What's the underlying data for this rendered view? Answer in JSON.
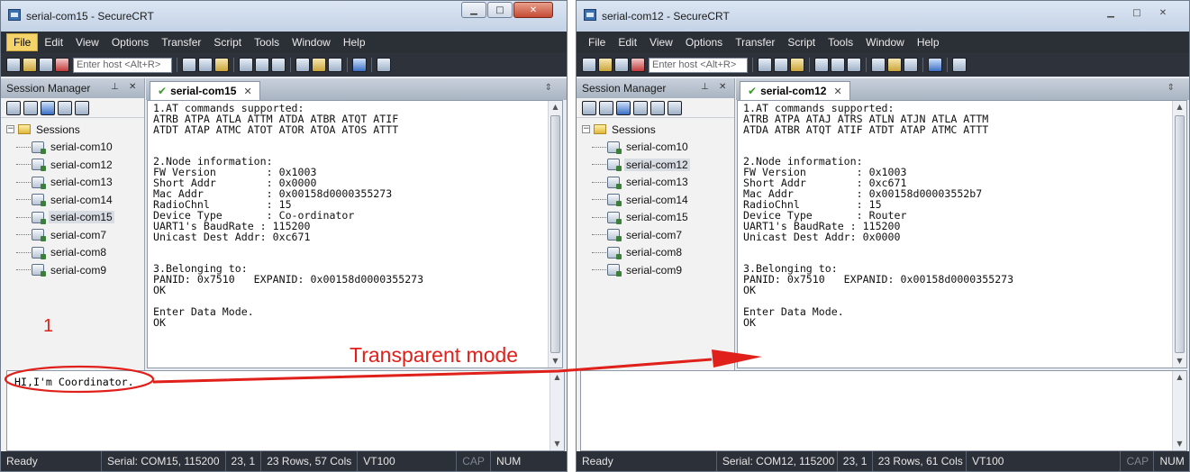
{
  "window_left": {
    "title": "serial-com15 - SecureCRT",
    "menu": [
      "File",
      "Edit",
      "View",
      "Options",
      "Transfer",
      "Script",
      "Tools",
      "Window",
      "Help"
    ],
    "host_placeholder": "Enter host <Alt+R>",
    "session_manager": {
      "title": "Session Manager",
      "root": "Sessions",
      "items": [
        "serial-com10",
        "serial-com12",
        "serial-com13",
        "serial-com14",
        "serial-com15",
        "serial-com7",
        "serial-com8",
        "serial-com9"
      ],
      "selected": "serial-com15"
    },
    "tab": "serial-com15",
    "terminal_lines": [
      "1.AT commands supported:",
      "ATRB ATPA ATLA ATTM ATDA ATBR ATQT ATIF",
      "ATDT ATAP ATMC ATOT ATOR ATOA ATOS ATTT",
      "",
      "",
      "2.Node information:",
      "FW Version        : 0x1003",
      "Short Addr        : 0x0000",
      "Mac Addr          : 0x00158d0000355273",
      "RadioChnl         : 15",
      "Device Type       : Co-ordinator",
      "UART1's BaudRate : 115200",
      "Unicast Dest Addr: 0xc671",
      "",
      "",
      "3.Belonging to:",
      "PANID: 0x7510   EXPANID: 0x00158d0000355273",
      "OK",
      "",
      "Enter Data Mode.",
      "OK"
    ],
    "chat_text": "HI,I'm Coordinator.",
    "status": {
      "state": "Ready",
      "serial": "Serial: COM15, 115200",
      "cursor": "23,  1",
      "size": "23 Rows, 57 Cols",
      "emulation": "VT100",
      "cap": "CAP",
      "num": "NUM"
    }
  },
  "window_right": {
    "title": "serial-com12 - SecureCRT",
    "menu": [
      "File",
      "Edit",
      "View",
      "Options",
      "Transfer",
      "Script",
      "Tools",
      "Window",
      "Help"
    ],
    "host_placeholder": "Enter host <Alt+R>",
    "session_manager": {
      "title": "Session Manager",
      "root": "Sessions",
      "items": [
        "serial-com10",
        "serial-com12",
        "serial-com13",
        "serial-com14",
        "serial-com15",
        "serial-com7",
        "serial-com8",
        "serial-com9"
      ],
      "selected": "serial-com12"
    },
    "tab": "serial-com12",
    "terminal_lines": [
      "1.AT commands supported:",
      "ATRB ATPA ATAJ ATRS ATLN ATJN ATLA ATTM",
      "ATDA ATBR ATQT ATIF ATDT ATAP ATMC ATTT",
      "",
      "",
      "2.Node information:",
      "FW Version        : 0x1003",
      "Short Addr        : 0xc671",
      "Mac Addr          : 0x00158d00003552b7",
      "RadioChnl         : 15",
      "Device Type       : Router",
      "UART1's BaudRate : 115200",
      "Unicast Dest Addr: 0x0000",
      "",
      "",
      "3.Belonging to:",
      "PANID: 0x7510   EXPANID: 0x00158d0000355273",
      "OK",
      "",
      "Enter Data Mode.",
      "OK"
    ],
    "chat_text": "",
    "status": {
      "state": "Ready",
      "serial": "Serial: COM12, 115200",
      "cursor": "23,  1",
      "size": "23 Rows, 61 Cols",
      "emulation": "VT100",
      "cap": "CAP",
      "num": "NUM"
    }
  },
  "annotation": {
    "number": "1",
    "label": "Transparent mode",
    "color": "#e0201a"
  },
  "colors": {
    "menubar": "#2b2f36",
    "file_menu_highlight": "#f4d36b",
    "statusbar": "#2c3038",
    "annotation": "#e0201a"
  },
  "icons": [
    "app-icon",
    "close-icon",
    "minimize-icon",
    "maximize-icon",
    "folder-icon",
    "session-icon",
    "check-icon"
  ]
}
